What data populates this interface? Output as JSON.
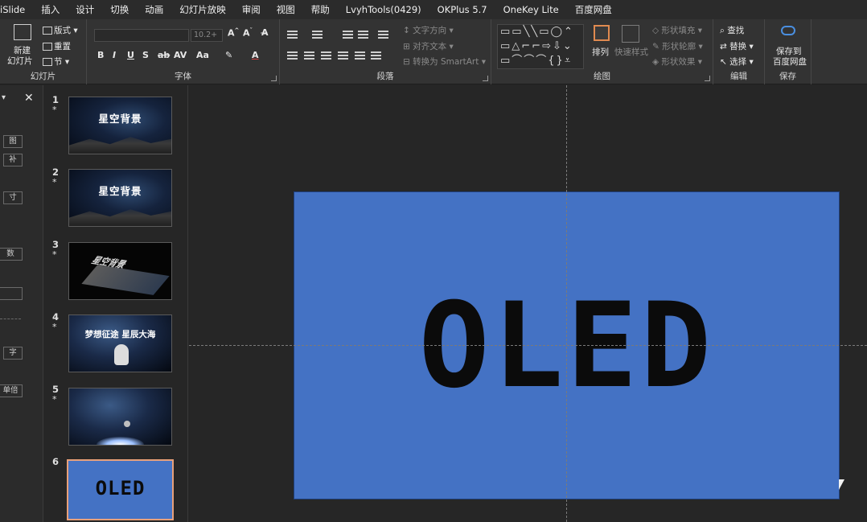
{
  "menu": [
    "iSlide",
    "插入",
    "设计",
    "切换",
    "动画",
    "幻灯片放映",
    "审阅",
    "视图",
    "帮助",
    "LvyhTools(0429)",
    "OKPlus 5.7",
    "OneKey Lite",
    "百度网盘"
  ],
  "ribbon": {
    "slides": {
      "label": "幻灯片",
      "new_slide": "新建",
      "new_slide2": "幻灯片",
      "layout": "版式",
      "reset": "重置",
      "section": "节"
    },
    "font": {
      "label": "字体",
      "size": "10.2+"
    },
    "paragraph": {
      "label": "段落",
      "text_direction": "文字方向",
      "align_text": "对齐文本",
      "smartart": "转换为 SmartArt"
    },
    "drawing": {
      "label": "绘图",
      "arrange": "排列",
      "quick_styles": "快速样式",
      "fill": "形状填充",
      "outline": "形状轮廓",
      "effects": "形状效果"
    },
    "editing": {
      "label": "编辑",
      "find": "查找",
      "replace": "替换",
      "select": "选择"
    },
    "save": {
      "label": "保存",
      "save_to": "保存到",
      "baidu": "百度网盘"
    }
  },
  "taskpane": {
    "b1": "图",
    "b2": "补",
    "b3": "寸",
    "b4": "数",
    "b5": "字",
    "b6": "单倍"
  },
  "slides": [
    {
      "num": "1",
      "star": "*",
      "title": "星空背景"
    },
    {
      "num": "2",
      "star": "*",
      "title": "星空背景"
    },
    {
      "num": "3",
      "star": "*",
      "title": "星空背景"
    },
    {
      "num": "4",
      "star": "*",
      "title": "梦想征途 星辰大海"
    },
    {
      "num": "5",
      "star": "*"
    },
    {
      "num": "6",
      "title": "OLED"
    }
  ],
  "current_slide": {
    "text": "OLED",
    "background": "#4472c4"
  },
  "colors": {
    "accent": "#4472c4",
    "selection": "#e8a07a"
  }
}
